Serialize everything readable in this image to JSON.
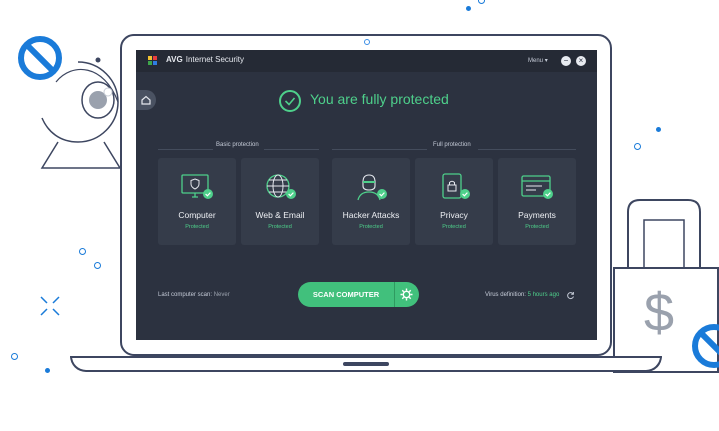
{
  "app": {
    "brand": "AVG",
    "name": "Internet Security",
    "menu_label": "Menu",
    "minimize_glyph": "−",
    "close_glyph": "×"
  },
  "status": {
    "text": "You are fully protected"
  },
  "sections": {
    "basic": "Basic protection",
    "full": "Full protection"
  },
  "cards": [
    {
      "label": "Computer",
      "status": "Protected",
      "icon": "monitor-shield-icon"
    },
    {
      "label": "Web & Email",
      "status": "Protected",
      "icon": "globe-icon"
    },
    {
      "label": "Hacker Attacks",
      "status": "Protected",
      "icon": "hacker-icon"
    },
    {
      "label": "Privacy",
      "status": "Protected",
      "icon": "lock-icon"
    },
    {
      "label": "Payments",
      "status": "Protected",
      "icon": "credit-card-icon"
    }
  ],
  "footer": {
    "last_scan_label": "Last computer scan:",
    "last_scan_value": "Never",
    "scan_button": "SCAN COMPUTER",
    "virus_def_label": "Virus definition:",
    "virus_def_value": "5 hours ago"
  },
  "decor": {
    "dollar": "$"
  },
  "colors": {
    "accent_green": "#4ed08b",
    "app_bg": "#2c3240",
    "card_bg": "#353c4a",
    "brand_blue": "#1a7bd9",
    "outline": "#3d4660"
  }
}
